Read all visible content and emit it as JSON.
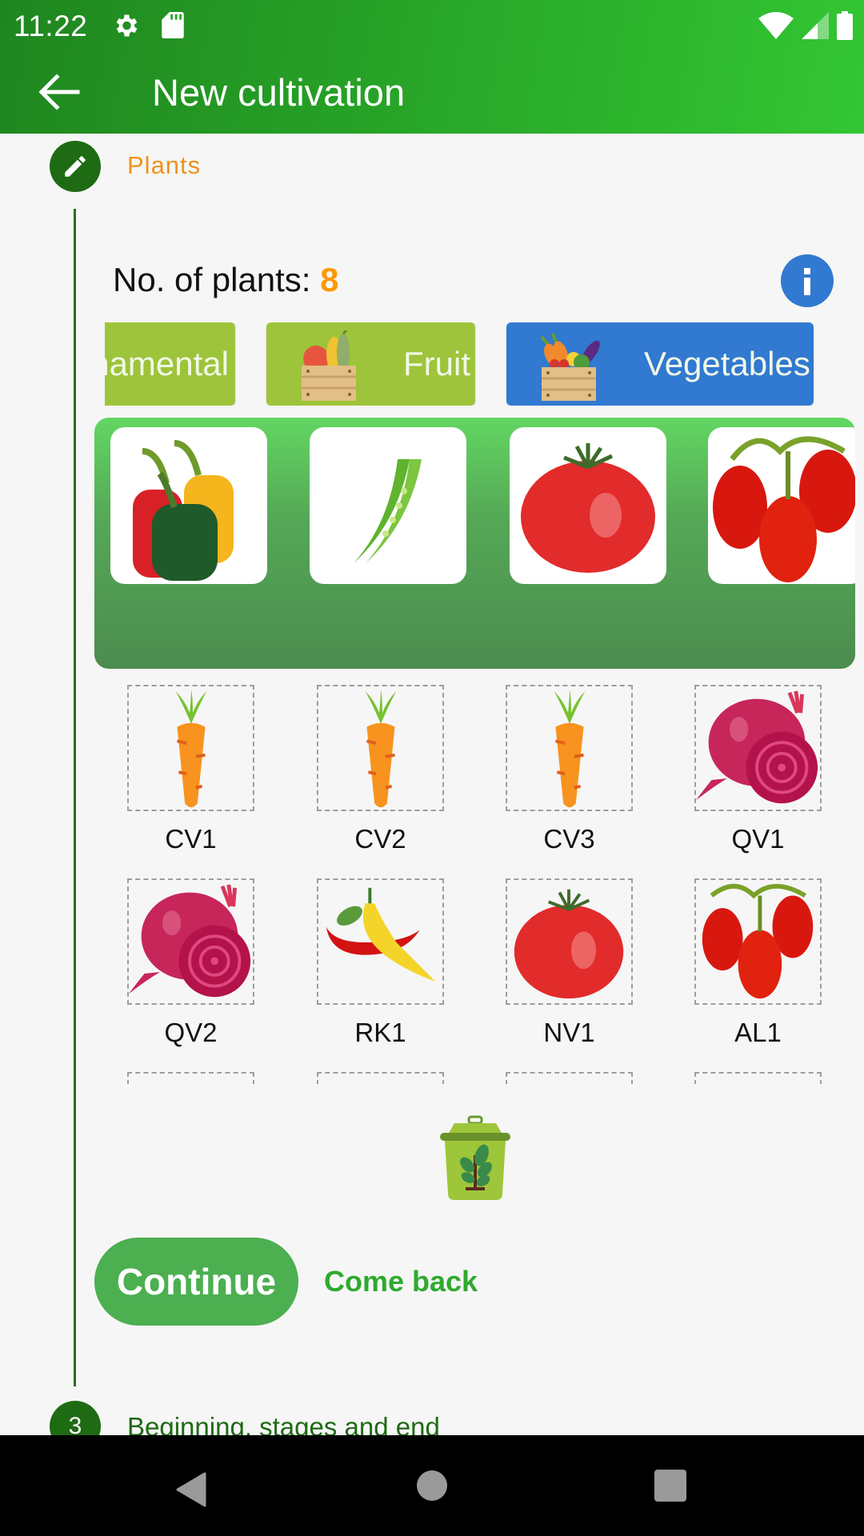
{
  "status_bar": {
    "time": "11:22",
    "left_icons": [
      "gear-icon",
      "sd-card-icon"
    ],
    "right_icons": [
      "wifi-icon",
      "cell-signal-icon",
      "battery-icon"
    ]
  },
  "app_bar": {
    "title": "New cultivation",
    "back_icon": "arrow-left-icon"
  },
  "stepper": {
    "active_step": {
      "icon": "pencil-icon",
      "label": "Plants"
    },
    "next_step": {
      "number": "3",
      "label": "Beginning, stages and end"
    }
  },
  "plants": {
    "count_label": "No. of plants:",
    "count_value": "8",
    "info_icon": "info-icon"
  },
  "categories": [
    {
      "label": "Ornamental",
      "visible_label": "namental",
      "selected": false,
      "color": "#9dc43a"
    },
    {
      "label": "Fruit",
      "selected": false,
      "color": "#9dc43a"
    },
    {
      "label": "Vegetables",
      "selected": true,
      "color": "#3179d1"
    }
  ],
  "carousel": {
    "items": [
      {
        "name": "bell peppers"
      },
      {
        "name": "peas"
      },
      {
        "name": "tomato"
      },
      {
        "name": "plum tomatoes"
      }
    ]
  },
  "selected_plants": [
    {
      "code": "CV1",
      "type": "carrot"
    },
    {
      "code": "CV2",
      "type": "carrot"
    },
    {
      "code": "CV3",
      "type": "carrot"
    },
    {
      "code": "QV1",
      "type": "beet"
    },
    {
      "code": "QV2",
      "type": "beet"
    },
    {
      "code": "RK1",
      "type": "chili peppers"
    },
    {
      "code": "NV1",
      "type": "tomato"
    },
    {
      "code": "AL1",
      "type": "plum tomatoes"
    }
  ],
  "actions": {
    "delete_icon": "plant-bin-icon",
    "continue_label": "Continue",
    "come_back_label": "Come back"
  },
  "colors": {
    "app_bar": "#27a327",
    "accent_orange": "#ff9800",
    "step_green": "#1e6b14",
    "continue_green": "#4caf50",
    "selected_category_blue": "#3179d1"
  }
}
